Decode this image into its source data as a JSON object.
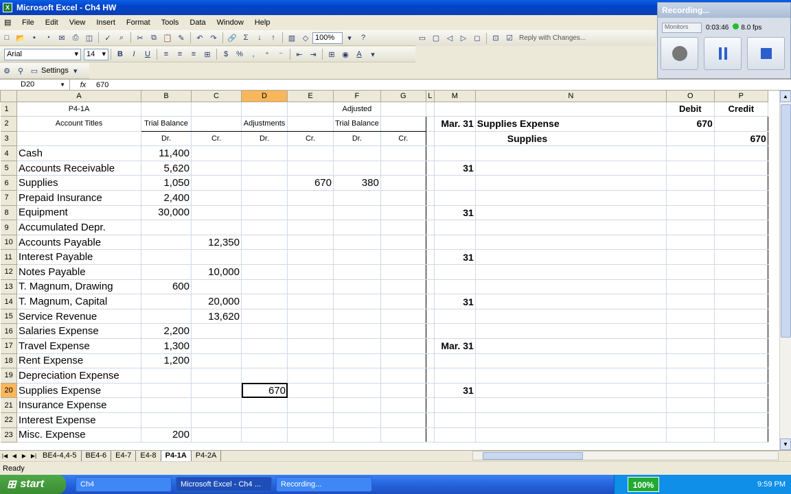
{
  "window": {
    "title": "Microsoft Excel - Ch4 HW"
  },
  "menu": [
    "File",
    "Edit",
    "View",
    "Insert",
    "Format",
    "Tools",
    "Data",
    "Window",
    "Help"
  ],
  "toolbar": {
    "zoom": "100%",
    "reply": "Reply with Changes...",
    "font_name": "Arial",
    "font_size": "14",
    "bold": "B",
    "italic": "I",
    "underline": "U",
    "currency": "$",
    "percent": "%",
    "comma": ",",
    "settings": "Settings"
  },
  "recorder": {
    "title": "Recording...",
    "combo": "Monitors",
    "time": "0:03:46",
    "fps": "8.0 fps"
  },
  "formula_bar": {
    "name_box": "D20",
    "fx": "fx",
    "value": "670"
  },
  "columns": [
    "A",
    "B",
    "C",
    "D",
    "E",
    "F",
    "G",
    "L",
    "M",
    "N",
    "O",
    "P"
  ],
  "rows": [
    {
      "n": "1",
      "A": "P4-1A",
      "B": "",
      "C": "",
      "D": "",
      "E": "",
      "F": "Adjusted",
      "G": "",
      "M": "",
      "N": "",
      "O": "Debit",
      "P": "Credit"
    },
    {
      "n": "2",
      "A": "Account Titles",
      "B": "Trial Balance",
      "C": "",
      "D": "Adjustments",
      "E": "",
      "F": "Trial Balance",
      "G": "",
      "M": "Mar. 31",
      "N": "Supplies Expense",
      "O": "670",
      "P": ""
    },
    {
      "n": "3",
      "A": "",
      "B": "Dr.",
      "C": "Cr.",
      "D": "Dr.",
      "E": "Cr.",
      "F": "Dr.",
      "G": "Cr.",
      "M": "",
      "N": "Supplies",
      "O": "",
      "P": "670"
    },
    {
      "n": "4",
      "A": "Cash",
      "B": "11,400",
      "C": "",
      "D": "",
      "E": "",
      "F": "",
      "G": "",
      "M": "",
      "N": "",
      "O": "",
      "P": ""
    },
    {
      "n": "5",
      "A": "Accounts Receivable",
      "B": "5,620",
      "C": "",
      "D": "",
      "E": "",
      "F": "",
      "G": "",
      "M": "31",
      "N": "",
      "O": "",
      "P": ""
    },
    {
      "n": "6",
      "A": "Supplies",
      "B": "1,050",
      "C": "",
      "D": "",
      "E": "670",
      "F": "380",
      "G": "",
      "M": "",
      "N": "",
      "O": "",
      "P": ""
    },
    {
      "n": "7",
      "A": "Prepaid Insurance",
      "B": "2,400",
      "C": "",
      "D": "",
      "E": "",
      "F": "",
      "G": "",
      "M": "",
      "N": "",
      "O": "",
      "P": ""
    },
    {
      "n": "8",
      "A": "Equipment",
      "B": "30,000",
      "C": "",
      "D": "",
      "E": "",
      "F": "",
      "G": "",
      "M": "31",
      "N": "",
      "O": "",
      "P": ""
    },
    {
      "n": "9",
      "A": "Accumulated Depr.",
      "B": "",
      "C": "",
      "D": "",
      "E": "",
      "F": "",
      "G": "",
      "M": "",
      "N": "",
      "O": "",
      "P": ""
    },
    {
      "n": "10",
      "A": "Accounts Payable",
      "B": "",
      "C": "12,350",
      "D": "",
      "E": "",
      "F": "",
      "G": "",
      "M": "",
      "N": "",
      "O": "",
      "P": ""
    },
    {
      "n": "11",
      "A": "Interest Payable",
      "B": "",
      "C": "",
      "D": "",
      "E": "",
      "F": "",
      "G": "",
      "M": "31",
      "N": "",
      "O": "",
      "P": ""
    },
    {
      "n": "12",
      "A": "Notes Payable",
      "B": "",
      "C": "10,000",
      "D": "",
      "E": "",
      "F": "",
      "G": "",
      "M": "",
      "N": "",
      "O": "",
      "P": ""
    },
    {
      "n": "13",
      "A": "T. Magnum, Drawing",
      "B": "600",
      "C": "",
      "D": "",
      "E": "",
      "F": "",
      "G": "",
      "M": "",
      "N": "",
      "O": "",
      "P": ""
    },
    {
      "n": "14",
      "A": "T. Magnum, Capital",
      "B": "",
      "C": "20,000",
      "D": "",
      "E": "",
      "F": "",
      "G": "",
      "M": "31",
      "N": "",
      "O": "",
      "P": ""
    },
    {
      "n": "15",
      "A": "Service Revenue",
      "B": "",
      "C": "13,620",
      "D": "",
      "E": "",
      "F": "",
      "G": "",
      "M": "",
      "N": "",
      "O": "",
      "P": ""
    },
    {
      "n": "16",
      "A": "Salaries Expense",
      "B": "2,200",
      "C": "",
      "D": "",
      "E": "",
      "F": "",
      "G": "",
      "M": "",
      "N": "",
      "O": "",
      "P": ""
    },
    {
      "n": "17",
      "A": "Travel Expense",
      "B": "1,300",
      "C": "",
      "D": "",
      "E": "",
      "F": "",
      "G": "",
      "M": "Mar. 31",
      "N": "",
      "O": "",
      "P": ""
    },
    {
      "n": "18",
      "A": "Rent Expense",
      "B": "1,200",
      "C": "",
      "D": "",
      "E": "",
      "F": "",
      "G": "",
      "M": "",
      "N": "",
      "O": "",
      "P": ""
    },
    {
      "n": "19",
      "A": "Depreciation Expense",
      "B": "",
      "C": "",
      "D": "",
      "E": "",
      "F": "",
      "G": "",
      "M": "",
      "N": "",
      "O": "",
      "P": ""
    },
    {
      "n": "20",
      "A": "Supplies Expense",
      "B": "",
      "C": "",
      "D": "670",
      "E": "",
      "F": "",
      "G": "",
      "M": "31",
      "N": "",
      "O": "",
      "P": ""
    },
    {
      "n": "21",
      "A": "Insurance Expense",
      "B": "",
      "C": "",
      "D": "",
      "E": "",
      "F": "",
      "G": "",
      "M": "",
      "N": "",
      "O": "",
      "P": ""
    },
    {
      "n": "22",
      "A": "Interest Expense",
      "B": "",
      "C": "",
      "D": "",
      "E": "",
      "F": "",
      "G": "",
      "M": "",
      "N": "",
      "O": "",
      "P": ""
    },
    {
      "n": "23",
      "A": "Misc. Expense",
      "B": "200",
      "C": "",
      "D": "",
      "E": "",
      "F": "",
      "G": "",
      "M": "",
      "N": "",
      "O": "",
      "P": ""
    }
  ],
  "sheet_tabs": [
    "BE4-4,4-5",
    "BE4-6",
    "E4-7",
    "E4-8",
    "P4-1A",
    "P4-2A"
  ],
  "active_tab": "P4-1A",
  "status": "Ready",
  "taskbar": {
    "start": "start",
    "tasks": [
      "Ch4",
      "Microsoft Excel - Ch4 ...",
      "Recording..."
    ],
    "zoom": "100%",
    "clock": "9:59 PM"
  },
  "colors": {
    "header_selected": "#f9b65b",
    "titlebar": "#0a5fe6",
    "taskbar": "#2564dd",
    "start": "#3a8d30"
  }
}
